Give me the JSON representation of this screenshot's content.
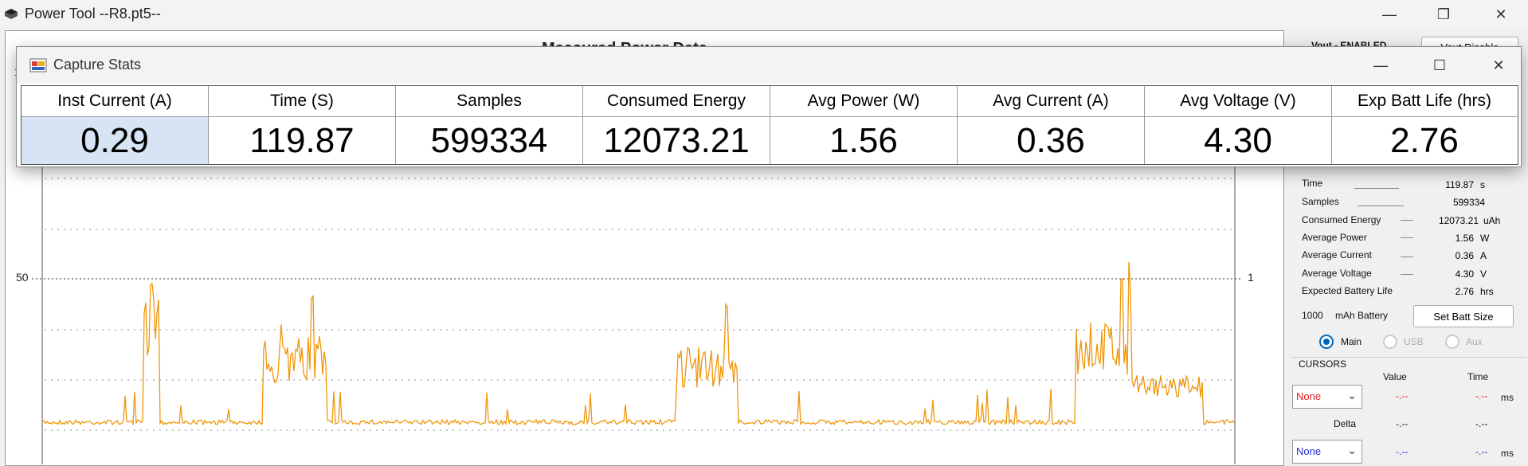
{
  "app": {
    "title": "Power Tool --R8.pt5--",
    "controls": {
      "minimize": "—",
      "restore": "❐",
      "close": "✕"
    }
  },
  "main_chart": {
    "title": "Measured Power Data",
    "y_left_ticks": [
      "1",
      "50"
    ],
    "y_right_ticks": [
      "1"
    ]
  },
  "right_panel": {
    "vout_label": "Vout - ENABLED",
    "vout_button": "Vout Disable",
    "stats": [
      {
        "label": "Time",
        "value": "119.87",
        "unit": "s"
      },
      {
        "label": "Samples",
        "value": "599334",
        "unit": ""
      },
      {
        "label": "Consumed Energy",
        "value": "12073.21",
        "unit": "uAh"
      },
      {
        "label": "Average Power",
        "value": "1.56",
        "unit": "W"
      },
      {
        "label": "Average Current",
        "value": "0.36",
        "unit": "A"
      },
      {
        "label": "Average Voltage",
        "value": "4.30",
        "unit": "V"
      },
      {
        "label": "Expected Battery Life",
        "value": "2.76",
        "unit": "hrs"
      }
    ],
    "battery_capacity": "1000",
    "battery_label": "mAh Battery",
    "set_batt_button": "Set Batt Size",
    "channels": [
      {
        "label": "Main",
        "checked": true
      },
      {
        "label": "USB",
        "checked": false
      },
      {
        "label": "Aux",
        "checked": false
      }
    ],
    "cursors": {
      "title": "CURSORS",
      "value_header": "Value",
      "time_header": "Time",
      "cursor1_select": "None",
      "cursor1_value": "-.--",
      "cursor1_time": "-.--",
      "cursor1_unit": "ms",
      "delta_label": "Delta",
      "delta_value": "-.--",
      "delta_time": "-.--",
      "cursor2_select": "None",
      "cursor2_value": "-.--",
      "cursor2_time": "-.--",
      "cursor2_unit": "ms"
    }
  },
  "capture_stats": {
    "window_title": "Capture Stats",
    "columns": [
      {
        "header": "Inst Current (A)",
        "value": "0.29"
      },
      {
        "header": "Time (S)",
        "value": "119.87"
      },
      {
        "header": "Samples",
        "value": "599334"
      },
      {
        "header": "Consumed Energy",
        "value": "12073.21"
      },
      {
        "header": "Avg Power (W)",
        "value": "1.56"
      },
      {
        "header": "Avg Current (A)",
        "value": "0.36"
      },
      {
        "header": "Avg Voltage (V)",
        "value": "4.30"
      },
      {
        "header": "Exp Batt Life (hrs)",
        "value": "2.76"
      }
    ]
  },
  "colors": {
    "trace": "#f0960a",
    "selected_cell": "#d6e4f3",
    "cursor1": "#e02020",
    "cursor2": "#2030d0"
  }
}
